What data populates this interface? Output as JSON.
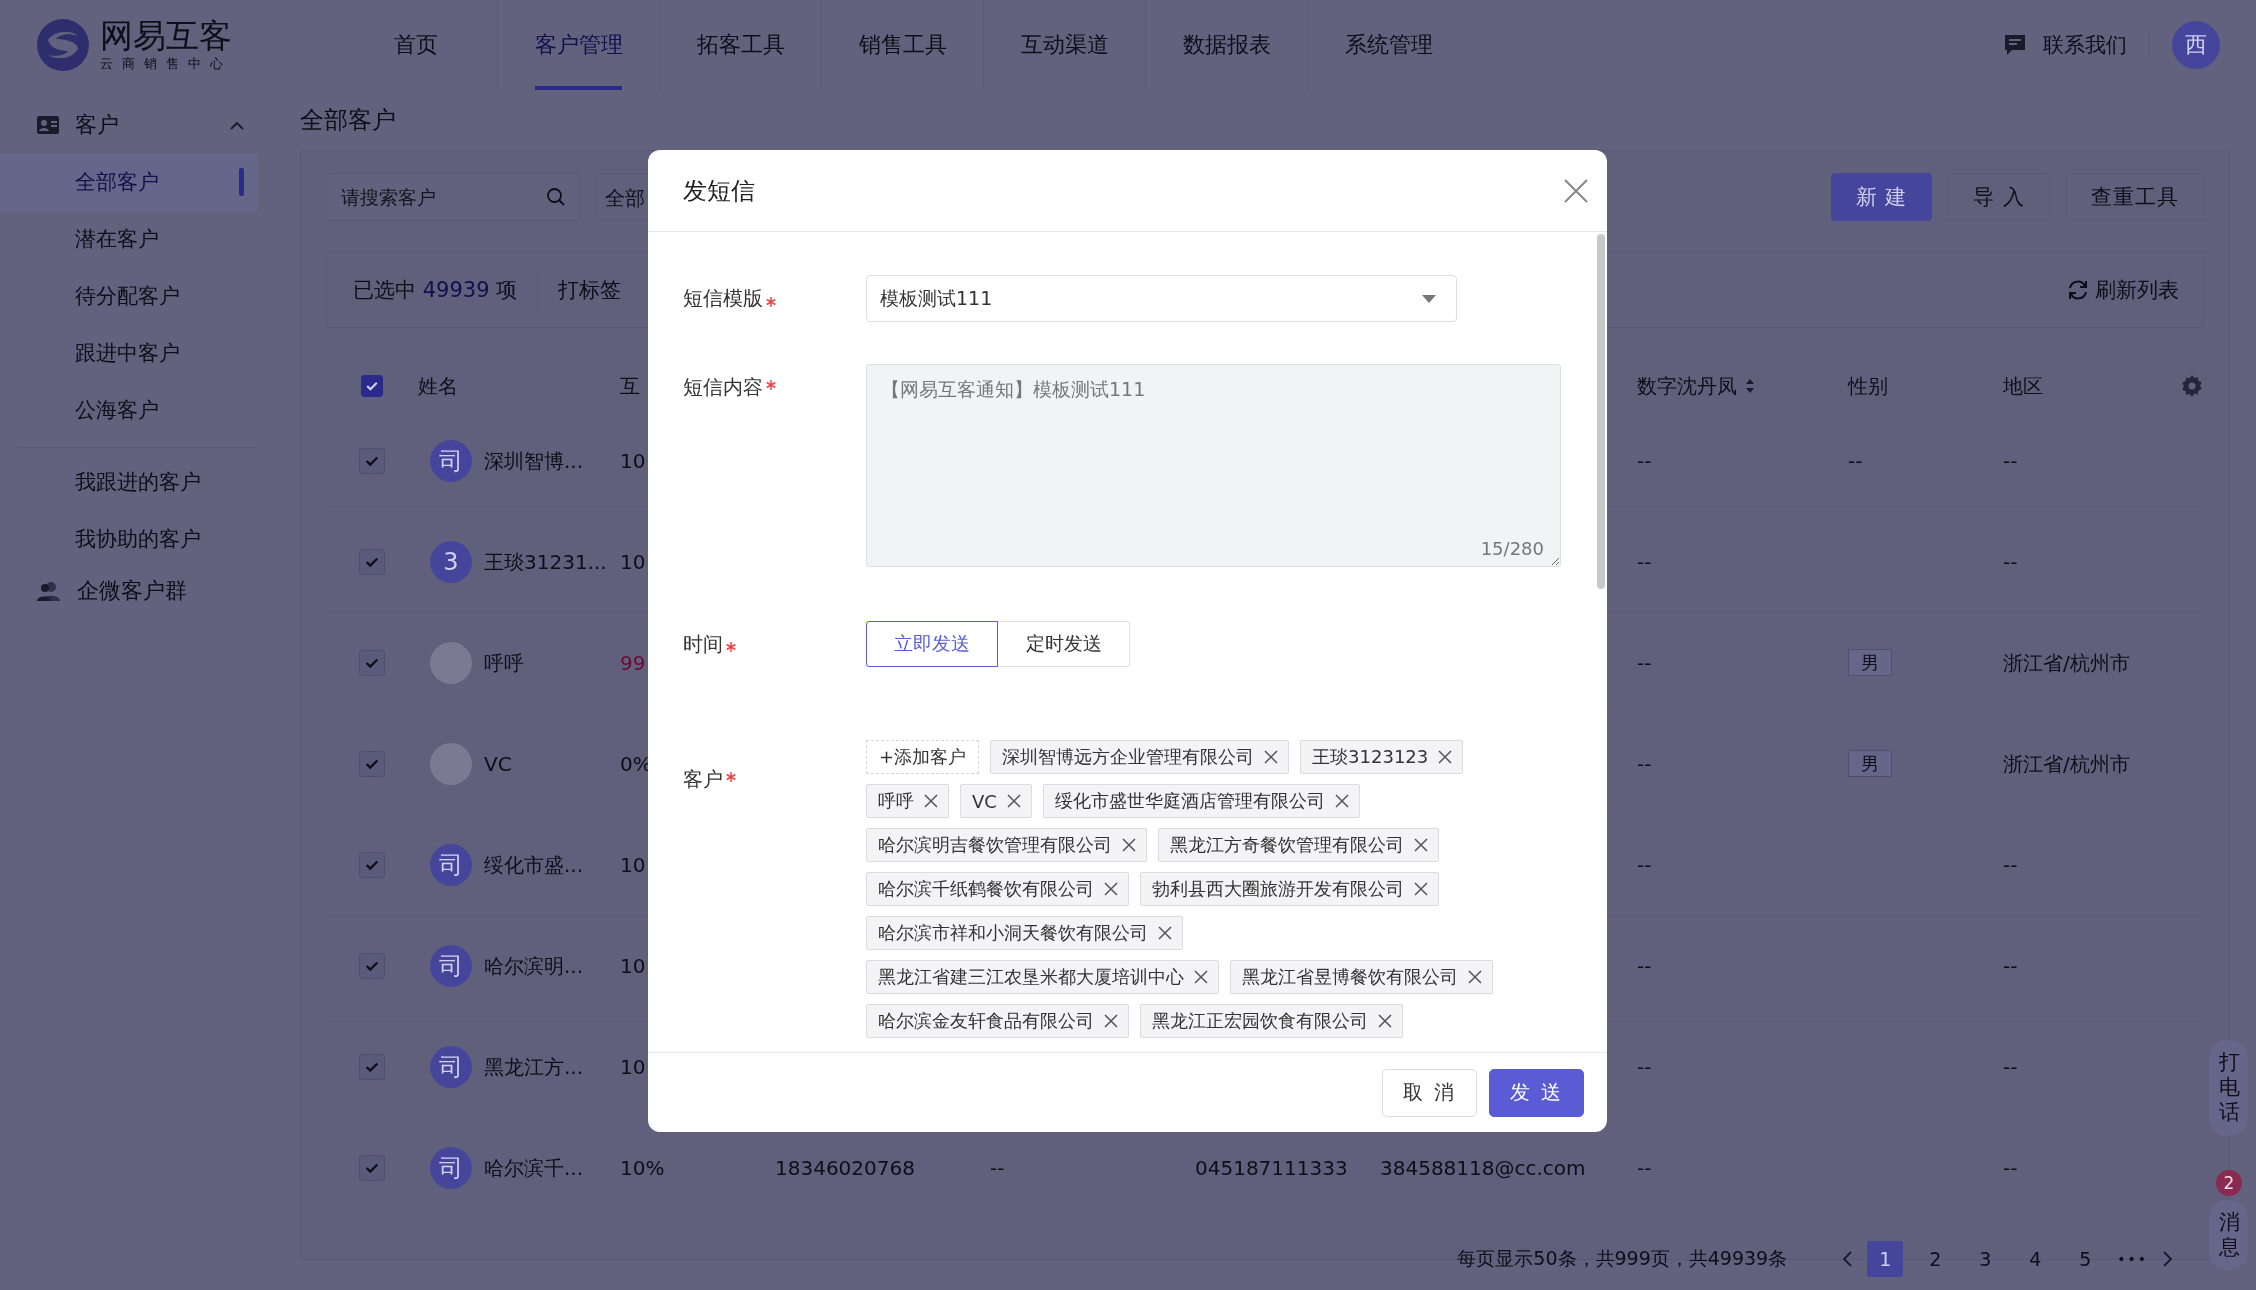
{
  "top_nav": {
    "logo": {
      "title": "网易互客",
      "subtitle": "云商销售中心"
    },
    "tabs": [
      {
        "label": "首页",
        "selected": false
      },
      {
        "label": "客户管理",
        "selected": true
      },
      {
        "label": "拓客工具",
        "selected": false
      },
      {
        "label": "销售工具",
        "selected": false
      },
      {
        "label": "互动渠道",
        "selected": false
      },
      {
        "label": "数据报表",
        "selected": false
      },
      {
        "label": "系统管理",
        "selected": false
      }
    ],
    "contact": "联系我们",
    "avatar": "西"
  },
  "sidebar": {
    "sections": [
      {
        "kind": "group",
        "label": "客户",
        "expanded": true,
        "children": [
          {
            "label": "全部客户",
            "selected": true
          },
          {
            "label": "潜在客户",
            "selected": false
          },
          {
            "label": "待分配客户",
            "selected": false
          },
          {
            "label": "跟进中客户",
            "selected": false
          },
          {
            "label": "公海客户",
            "selected": false
          }
        ]
      },
      {
        "kind": "list",
        "children": [
          {
            "label": "我跟进的客户",
            "selected": false
          },
          {
            "label": "我协助的客户",
            "selected": false
          }
        ]
      },
      {
        "kind": "group",
        "label": "企微客户群"
      }
    ]
  },
  "page": {
    "title": "全部客户",
    "search": {
      "placeholder": "请搜索客户"
    },
    "filter": "全部",
    "buttons": [
      {
        "label": "新 建",
        "kind": "primary"
      },
      {
        "label": "导 入",
        "kind": "default"
      },
      {
        "label": "查重工具",
        "kind": "default"
      }
    ],
    "selection": {
      "before": "已选中",
      "count": "49939",
      "after": "项",
      "action": "打标签",
      "refresh": "刷新列表"
    }
  },
  "table": {
    "header_checked": true,
    "columns": [
      {
        "label": "姓名",
        "sortable": false
      },
      {
        "label": "互",
        "sortable": false
      },
      {
        "label": "数字沈丹凤",
        "sortable": true
      },
      {
        "label": "性别",
        "sortable": false
      },
      {
        "label": "地区",
        "sortable": false
      }
    ],
    "rows": [
      {
        "checked": true,
        "avatar": {
          "kind": "text",
          "text": "司"
        },
        "name": "深圳智博...",
        "col_2": "10",
        "col_2_alert": false,
        "custom_field": "--",
        "gender": {
          "kind": "text",
          "text": "--"
        },
        "region": "--"
      },
      {
        "checked": true,
        "avatar": {
          "kind": "text",
          "text": "3"
        },
        "name": "王琰31231...",
        "col_2": "10",
        "col_2_alert": false,
        "custom_field": "--",
        "region": "--"
      },
      {
        "checked": true,
        "avatar": {
          "kind": "image"
        },
        "name": "呼呼",
        "col_2": "99",
        "col_2_alert": true,
        "custom_field": "--",
        "gender": {
          "kind": "tag",
          "text": "男"
        },
        "region": "浙江省/杭州市"
      },
      {
        "checked": true,
        "avatar": {
          "kind": "image"
        },
        "name": "VC",
        "col_2": "0%",
        "col_2_alert": false,
        "custom_field": "--",
        "gender": {
          "kind": "tag",
          "text": "男"
        },
        "region": "浙江省/杭州市"
      },
      {
        "checked": true,
        "avatar": {
          "kind": "text",
          "text": "司"
        },
        "name": "绥化市盛...",
        "col_2": "10",
        "col_2_alert": false,
        "custom_field": "--",
        "region": "--"
      },
      {
        "checked": true,
        "avatar": {
          "kind": "text",
          "text": "司"
        },
        "name": "哈尔滨明...",
        "col_2": "10",
        "col_2_alert": false,
        "custom_field": "--",
        "region": "--"
      },
      {
        "checked": true,
        "avatar": {
          "kind": "text",
          "text": "司"
        },
        "name": "黑龙江方...",
        "col_2": "10",
        "col_2_alert": false,
        "custom_field": "--",
        "region": "--"
      },
      {
        "checked": true,
        "avatar": {
          "kind": "text",
          "text": "司"
        },
        "name": "哈尔滨千...",
        "col_2": "10%",
        "col_2_alert": false,
        "column_3": "18346020768",
        "column_4": "--",
        "column_5": "045187111333",
        "column_6": "384588118@cc.com",
        "custom_field": "--",
        "region": "--"
      }
    ]
  },
  "pagination": {
    "summary": "每页显示50条，共999页，共49939条",
    "pages": [
      {
        "label": "1",
        "selected": true
      },
      {
        "label": "2",
        "selected": false
      },
      {
        "label": "3",
        "selected": false
      },
      {
        "label": "4",
        "selected": false
      },
      {
        "label": "5",
        "selected": false
      }
    ],
    "ellipsis": "•••"
  },
  "floating": {
    "call": "打电话",
    "messages": {
      "label": "消息",
      "badge": "2"
    }
  },
  "dialog": {
    "title": "发短信",
    "fields": [
      {
        "kind": "select",
        "label": "短信模版",
        "required": true,
        "value": "模板测试111"
      },
      {
        "kind": "textarea",
        "label": "短信内容",
        "required": true,
        "value": "【网易互客通知】模板测试111",
        "disabled": true,
        "counter": "15/280"
      },
      {
        "kind": "radio_buttons",
        "label": "时间",
        "required": true,
        "options": [
          {
            "label": "立即发送",
            "selected": true
          },
          {
            "label": "定时发送",
            "selected": false
          }
        ]
      },
      {
        "kind": "tags",
        "label": "客户",
        "required": true,
        "add_label": "+添加客户",
        "tags": [
          "深圳智博远方企业管理有限公司",
          "王琰3123123",
          "呼呼",
          "VC",
          "绥化市盛世华庭酒店管理有限公司",
          "哈尔滨明吉餐饮管理有限公司",
          "黑龙江方奇餐饮管理有限公司",
          "哈尔滨千纸鹤餐饮有限公司",
          "勃利县西大圈旅游开发有限公司",
          "哈尔滨市祥和小洞天餐饮有限公司",
          "黑龙江省建三江农垦米都大厦培训中心",
          "黑龙江省昱博餐饮有限公司",
          "哈尔滨金友轩食品有限公司",
          "黑龙江正宏园饮食有限公司"
        ]
      }
    ],
    "buttons": [
      {
        "label": "取 消",
        "kind": "default"
      },
      {
        "label": "发 送",
        "kind": "primary"
      }
    ]
  }
}
